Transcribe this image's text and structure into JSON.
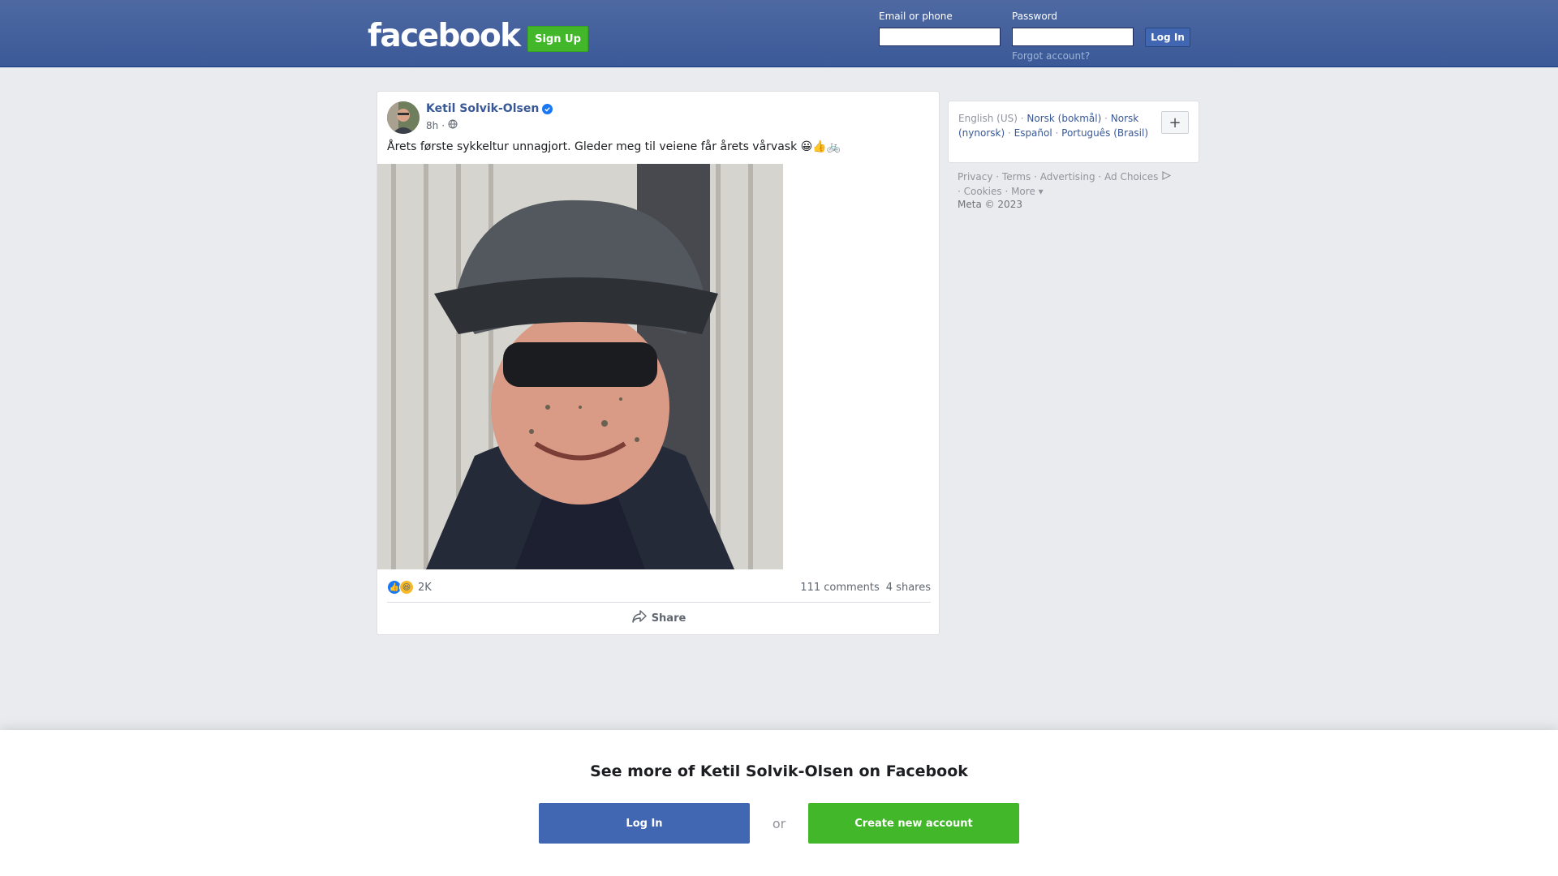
{
  "header": {
    "logo_text": "facebook",
    "signup_label": "Sign Up",
    "email_label": "Email or phone",
    "email_value": "",
    "password_label": "Password",
    "password_value": "",
    "login_label": "Log In",
    "forgot_label": "Forgot account?"
  },
  "post": {
    "author": "Ketil Solvik-Olsen",
    "verified": true,
    "time": "8h",
    "separator": "·",
    "audience_icon": "globe-icon",
    "text": "Årets første sykkeltur unnagjort. Gleder meg til veiene får årets vårvask 😀👍🚲",
    "photo_description_icon": "photo",
    "reactions": {
      "types": [
        "like",
        "haha"
      ],
      "count": "2K"
    },
    "comments": "111 comments",
    "shares": "4 shares",
    "share_label": "Share"
  },
  "languages": {
    "current": "English (US)",
    "items": [
      "Norsk (bokmål)",
      "Norsk (nynorsk)",
      "Español",
      "Português (Brasil)"
    ],
    "more_label": "+"
  },
  "footer": {
    "links": [
      "Privacy",
      "Terms",
      "Advertising",
      "Ad Choices",
      "Cookies",
      "More"
    ],
    "copyright": "Meta © 2023"
  },
  "banner": {
    "title": "See more of Ketil Solvik-Olsen on Facebook",
    "login_label": "Log In",
    "or_label": "or",
    "create_label": "Create new account"
  },
  "colors": {
    "brand_blue": "#3b5998",
    "link_blue": "#385898",
    "green": "#42b72a",
    "background": "#e9ebee"
  }
}
